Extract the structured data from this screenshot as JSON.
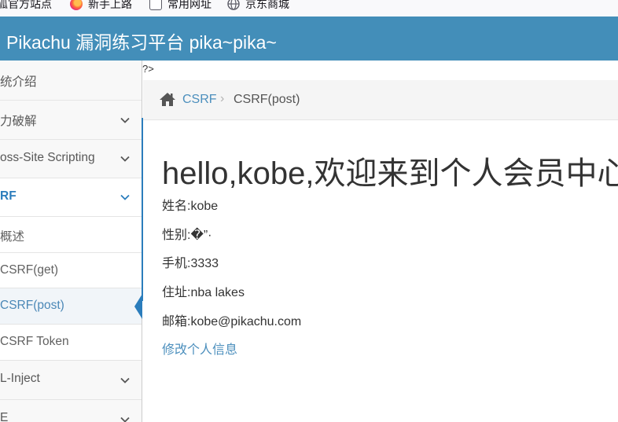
{
  "bookmarks": [
    {
      "label": "狐官方站点",
      "icon": "none"
    },
    {
      "label": "新手上路",
      "icon": "firefox-icon"
    },
    {
      "label": "常用网址",
      "icon": "folder-icon"
    },
    {
      "label": "京东商城",
      "icon": "globe-icon"
    }
  ],
  "header": {
    "title": "Pikachu 漏洞练习平台 pika~pika~"
  },
  "sidebar": {
    "items": [
      {
        "label": "统介绍"
      },
      {
        "label": "力破解"
      },
      {
        "label": "oss-Site Scripting"
      },
      {
        "label": "RF"
      },
      {
        "label": "L-Inject"
      },
      {
        "label": "E"
      }
    ],
    "csrf_children": [
      {
        "label": "概述"
      },
      {
        "label": "CSRF(get)"
      },
      {
        "label": "CSRF(post)"
      },
      {
        "label": "CSRF Token"
      }
    ]
  },
  "main": {
    "php_leak": "?>",
    "breadcrumb": {
      "link": "CSRF",
      "separator": "›",
      "current": "CSRF(post)"
    },
    "greeting": "hello,kobe,欢迎来到个人会员中心",
    "info": [
      "姓名:kobe",
      "性别:�”·",
      "手机:3333",
      "住址:nba lakes",
      "邮箱:kobe@pikachu.com"
    ],
    "edit_link": "修改个人信息"
  },
  "colors": {
    "navbar": "#438eb9",
    "accent": "#2b7dbc",
    "link": "#4c8fbd"
  }
}
